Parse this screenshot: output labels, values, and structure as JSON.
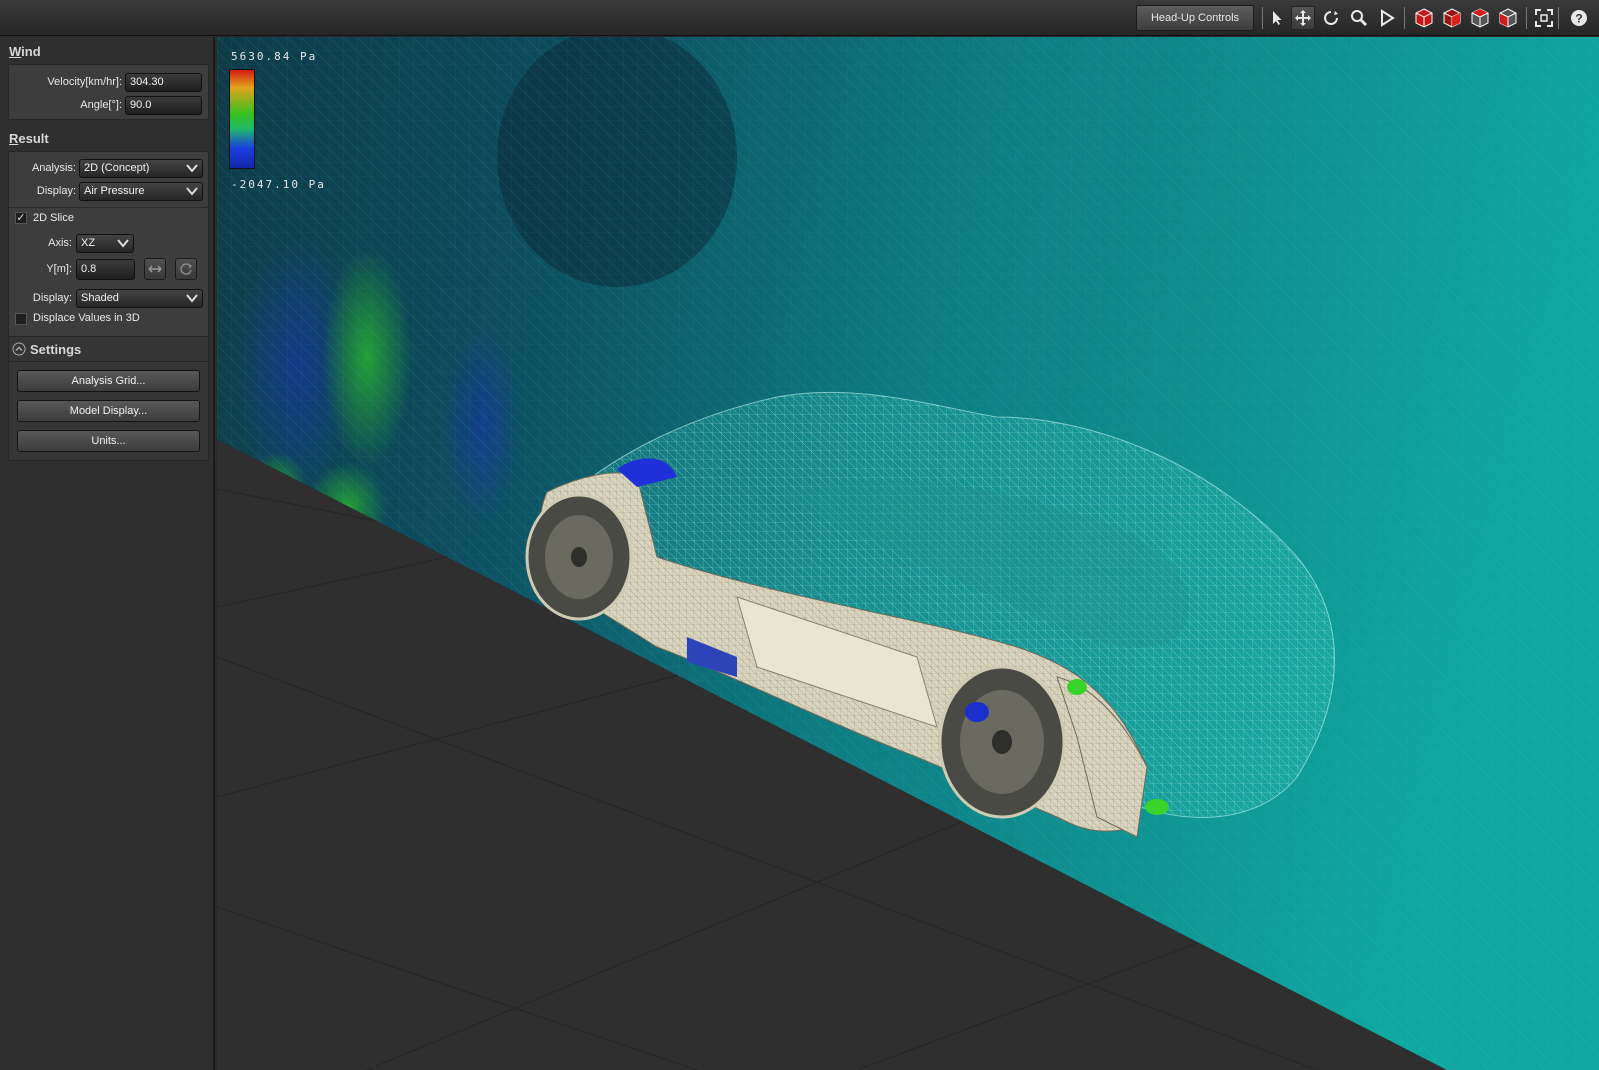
{
  "toolbar": {
    "hud_button": "Head-Up Controls",
    "tools": [
      "select-arrow-icon",
      "pan-icon",
      "orbit-icon",
      "zoom-icon",
      "play-icon",
      "view-cube-front-icon",
      "view-cube-side-icon",
      "view-cube-top-icon",
      "view-cube-iso-icon",
      "fit-view-icon",
      "help-icon"
    ]
  },
  "wind": {
    "title_first": "W",
    "title_rest": "ind",
    "velocity_label": "Velocity[km/hr]:",
    "velocity_value": "304.30",
    "angle_label": "Angle[°]:",
    "angle_value": "90.0"
  },
  "result": {
    "title_first": "R",
    "title_rest": "esult",
    "analysis_label": "Analysis:",
    "analysis_value": "2D (Concept)",
    "display_label": "Display:",
    "display_value": "Air Pressure",
    "slice_label": "2D Slice",
    "slice_checked": true,
    "axis_label": "Axis:",
    "axis_value": "XZ",
    "y_label": "Y[m]:",
    "y_value": "0.8",
    "shade_label": "Display:",
    "shade_value": "Shaded",
    "displace_label": "Displace Values in 3D",
    "displace_checked": false
  },
  "settings": {
    "title": "Settings",
    "buttons": [
      "Analysis Grid...",
      "Model Display...",
      "Units..."
    ]
  },
  "legend": {
    "max": "5630.84 Pa",
    "min": "-2047.10 Pa"
  },
  "colors": {
    "panel": "#3d3d3d",
    "flow_teal": "#0e9a97",
    "low_pressure": "#1b2fd0",
    "high_pressure": "#d21a10"
  }
}
